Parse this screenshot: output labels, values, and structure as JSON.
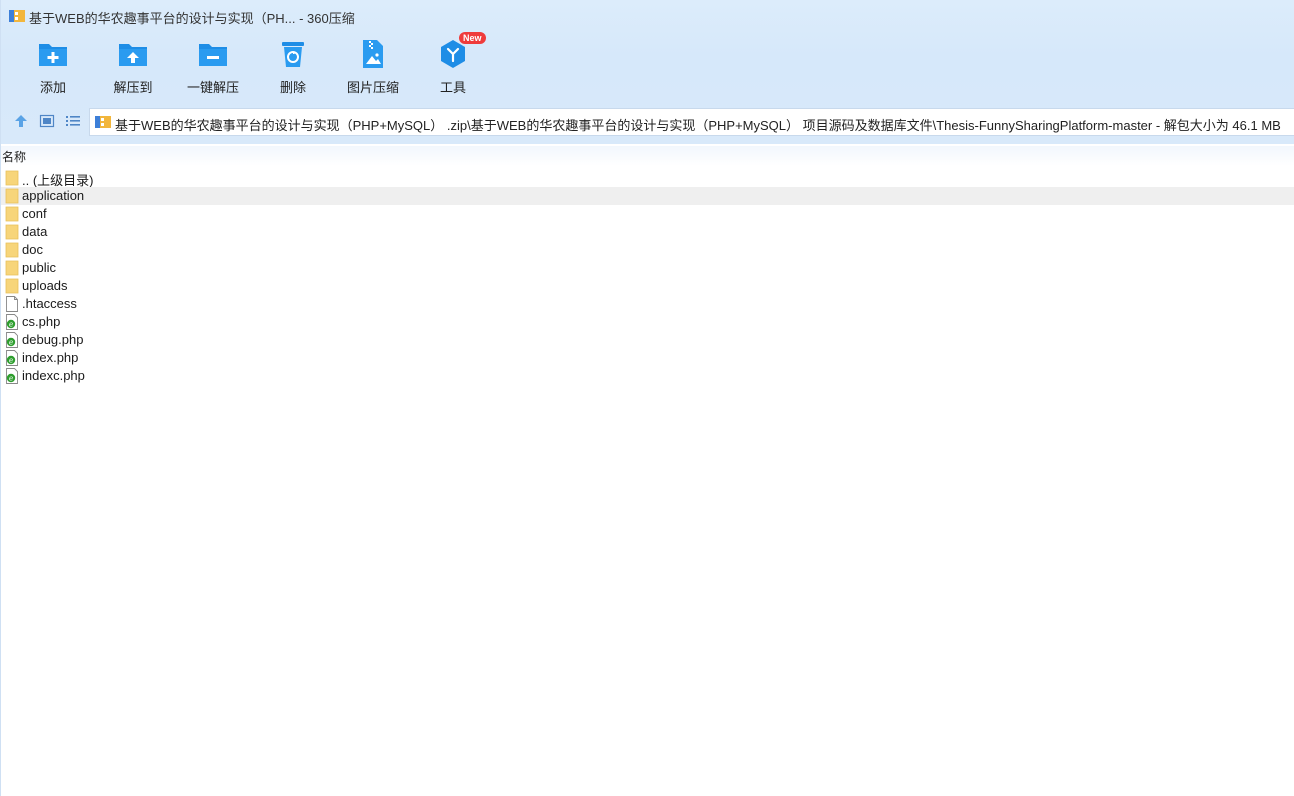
{
  "window": {
    "title": "基于WEB的华农趣事平台的设计与实现（PH... - 360压缩"
  },
  "toolbar": {
    "items": [
      {
        "label": "添加",
        "icon": "add-folder-icon"
      },
      {
        "label": "解压到",
        "icon": "extract-to-icon"
      },
      {
        "label": "一键解压",
        "icon": "one-click-extract-icon"
      },
      {
        "label": "删除",
        "icon": "trash-icon"
      },
      {
        "label": "图片压缩",
        "icon": "image-compress-icon"
      },
      {
        "label": "工具",
        "icon": "tools-cube-icon",
        "badge": "New"
      }
    ]
  },
  "nav": {
    "address": "基于WEB的华农趣事平台的设计与实现（PHP+MySQL） .zip\\基于WEB的华农趣事平台的设计与实现（PHP+MySQL） 项目源码及数据库文件\\Thesis-FunnySharingPlatform-master - 解包大小为 46.1 MB"
  },
  "list": {
    "column_name": "名称",
    "files": [
      {
        "name": ".. (上级目录)",
        "type": "folder"
      },
      {
        "name": "application",
        "type": "folder",
        "selected": true
      },
      {
        "name": "conf",
        "type": "folder"
      },
      {
        "name": "data",
        "type": "folder"
      },
      {
        "name": "doc",
        "type": "folder"
      },
      {
        "name": "public",
        "type": "folder"
      },
      {
        "name": "uploads",
        "type": "folder"
      },
      {
        "name": ".htaccess",
        "type": "file"
      },
      {
        "name": "cs.php",
        "type": "php"
      },
      {
        "name": "debug.php",
        "type": "php"
      },
      {
        "name": "index.php",
        "type": "php"
      },
      {
        "name": "indexc.php",
        "type": "php"
      }
    ]
  },
  "colors": {
    "accent": "#1e90e8",
    "toolbar_bg": "#d8e9fa",
    "selected_row": "#efefef",
    "folder": "#f7d57a"
  }
}
